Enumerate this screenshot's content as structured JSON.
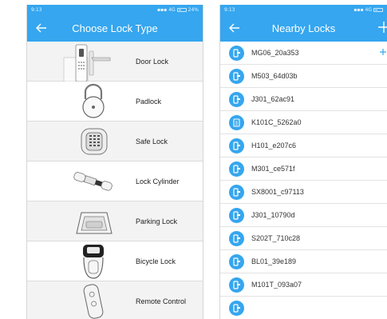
{
  "left_screen": {
    "status": {
      "time": "9:13",
      "network": "4G",
      "battery": "24%"
    },
    "title": "Choose Lock Type",
    "lock_types": [
      {
        "label": "Door Lock",
        "icon": "door-lock-image"
      },
      {
        "label": "Padlock",
        "icon": "padlock-image"
      },
      {
        "label": "Safe Lock",
        "icon": "safe-lock-image"
      },
      {
        "label": "Lock Cylinder",
        "icon": "lock-cylinder-image"
      },
      {
        "label": "Parking Lock",
        "icon": "parking-lock-image"
      },
      {
        "label": "Bicycle Lock",
        "icon": "bicycle-lock-image"
      },
      {
        "label": "Remote Control",
        "icon": "remote-control-image"
      }
    ]
  },
  "right_screen": {
    "status": {
      "time": "9:13",
      "network": "4G"
    },
    "title": "Nearby Locks",
    "locks": [
      {
        "name": "MG06_20a353",
        "icon": "lock-icon"
      },
      {
        "name": "M503_64d03b",
        "icon": "lock-icon"
      },
      {
        "name": "J301_62ac91",
        "icon": "lock-icon"
      },
      {
        "name": "K101C_5262a0",
        "icon": "keypad-icon"
      },
      {
        "name": "H101_e207c6",
        "icon": "lock-icon"
      },
      {
        "name": "M301_ce571f",
        "icon": "lock-icon"
      },
      {
        "name": "SX8001_c97113",
        "icon": "lock-icon"
      },
      {
        "name": "J301_10790d",
        "icon": "lock-icon"
      },
      {
        "name": "S202T_710c28",
        "icon": "lock-icon"
      },
      {
        "name": "BL01_39e189",
        "icon": "lock-icon"
      },
      {
        "name": "M101T_093a07",
        "icon": "lock-icon"
      }
    ]
  },
  "colors": {
    "accent": "#35a6ef",
    "row_alt": "#ffffff",
    "row_base": "#f3f3f3"
  }
}
